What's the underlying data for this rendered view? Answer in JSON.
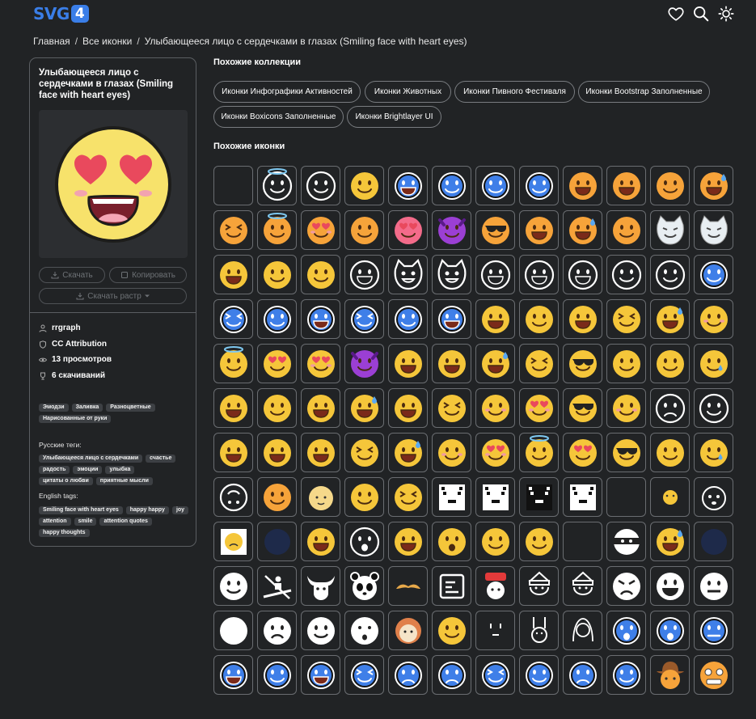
{
  "header": {
    "logo_text": "SVG",
    "logo_badge": "4"
  },
  "breadcrumb": {
    "home": "Главная",
    "all": "Все иконки",
    "current": "Улыбающееся лицо с сердечками в глазах (Smiling face with heart eyes)",
    "sep": "/"
  },
  "icon_card": {
    "title": "Улыбающееся лицо с сердечками в глазах (Smiling face with heart eyes)",
    "download_label": "Скачать",
    "copy_label": "Копировать",
    "raster_label": "Скачать растр",
    "author": "rrgraph",
    "license": "CC Attribution",
    "views": "13 просмотров",
    "downloads": "6 скачиваний",
    "categories": [
      "Эмодзи",
      "Заливка",
      "Разноцветные",
      "Нарисованные от руки"
    ],
    "ru_tags_label": "Русские теги:",
    "ru_tags": [
      "Улыбающееся лицо с сердечками",
      "счастье",
      "радость",
      "эмоции",
      "улыбка",
      "цитаты о любви",
      "приятные мысли"
    ],
    "en_tags_label": "English tags:",
    "en_tags": [
      "Smiling face with heart eyes",
      "happy happy",
      "joy",
      "attention",
      "smile",
      "attention quotes",
      "happy thoughts"
    ]
  },
  "collections": {
    "title": "Похожие коллекции",
    "items": [
      "Иконки Инфографики Активностей",
      "Иконки Животных",
      "Иконки Пивного Фестиваля",
      "Иконки Bootstrap Заполненные",
      "Иконки Boxicons Заполненные",
      "Иконки Brightlayer UI"
    ]
  },
  "similar": {
    "title": "Похожие иконки",
    "icons": [
      "blank",
      "halo-outline",
      "smile-outline",
      "tongue-yellow",
      "grin-blue",
      "smile-blue",
      "smile-blue",
      "smile-blue",
      "grin-orange",
      "crazy-orange",
      "tongue-orange",
      "sweat-orange",
      "squint-tongue-orange",
      "halo-orange",
      "hearts-orange",
      "smile-orange",
      "heart-eyes-pink",
      "devil-purple",
      "sunglasses-orange",
      "grin-orange",
      "sweat-laugh-orange",
      "raised-brow-orange",
      "cat-white",
      "cat-white",
      "grin-yellow",
      "smile-yellow",
      "smirk-yellow",
      "grin-outline",
      "cat-outline",
      "cat-outline",
      "grin-outline",
      "grin-outline",
      "grin-outline",
      "smile-outline",
      "smirk-outline",
      "smile-blue",
      "squint-blue",
      "smile-blue",
      "grin-blue",
      "squint-blue",
      "smile-blue",
      "grin-blue",
      "grin-yellow",
      "smile-yellow",
      "grin-yellow",
      "squint-yellow",
      "sweat-yellow",
      "blush-yellow",
      "halo-yellow",
      "heart-eyes-yellow",
      "hearts-yellow",
      "devil-purple",
      "grin-yellow",
      "grin-yellow",
      "sweat-yellow",
      "squint-yellow",
      "sunglasses-yellow",
      "smile-yellow",
      "smirk-yellow",
      "tear-yellow",
      "grin-yellow",
      "smile-yellow",
      "grin-yellow",
      "sweat-yellow",
      "grin-yellow",
      "squint-yellow",
      "blush-yellow",
      "hearts-yellow",
      "sunglasses-yellow",
      "blush-yellow",
      "sad-outline",
      "smirk-outline",
      "grin-yellow",
      "grin-yellow",
      "grin-yellow",
      "squint-yellow",
      "sweat-yellow",
      "blush-yellow",
      "hearts-yellow",
      "halo-yellow",
      "heart-eyes-yellow",
      "sunglasses-yellow",
      "smirk-yellow",
      "tear-yellow",
      "upside-outline",
      "smile-orange",
      "baby-yellow",
      "smile-yellow",
      "squint-yellow",
      "pixel-cat",
      "pixel-cat",
      "pixel-ghost",
      "pixel-cat",
      "blank",
      "tiny-yellow",
      "dog-outline",
      "sad-yellow",
      "dark-blue",
      "grin-yellow",
      "open-outline",
      "grin-yellow",
      "surprised-yellow",
      "smile-yellow",
      "wink-yellow",
      "blank",
      "ninja-outline",
      "sweat-yellow",
      "dark-blue",
      "smile-white",
      "kayak",
      "bull",
      "panda",
      "mustache",
      "terminal",
      "hat-face",
      "santa",
      "santa",
      "angry-white",
      "grin-white",
      "neutral-white",
      "blank-white",
      "sad-white",
      "smile-white",
      "surprise-white",
      "lion",
      "tongue-yellow",
      "glyph-tiny",
      "rabbit",
      "girl-outline",
      "open-blue",
      "shock-blue",
      "neutral-blue",
      "grin-blue",
      "smile-blue",
      "grin-blue",
      "squint-blue",
      "sad-blue",
      "cry-blue",
      "squint-blue",
      "happy-blue",
      "sad-blue",
      "smile-blue",
      "cowboy-orange",
      "grimace-orange"
    ]
  },
  "colors": {
    "accent": "#3a7ee8",
    "background": "#212325",
    "border": "#5b5e62"
  }
}
